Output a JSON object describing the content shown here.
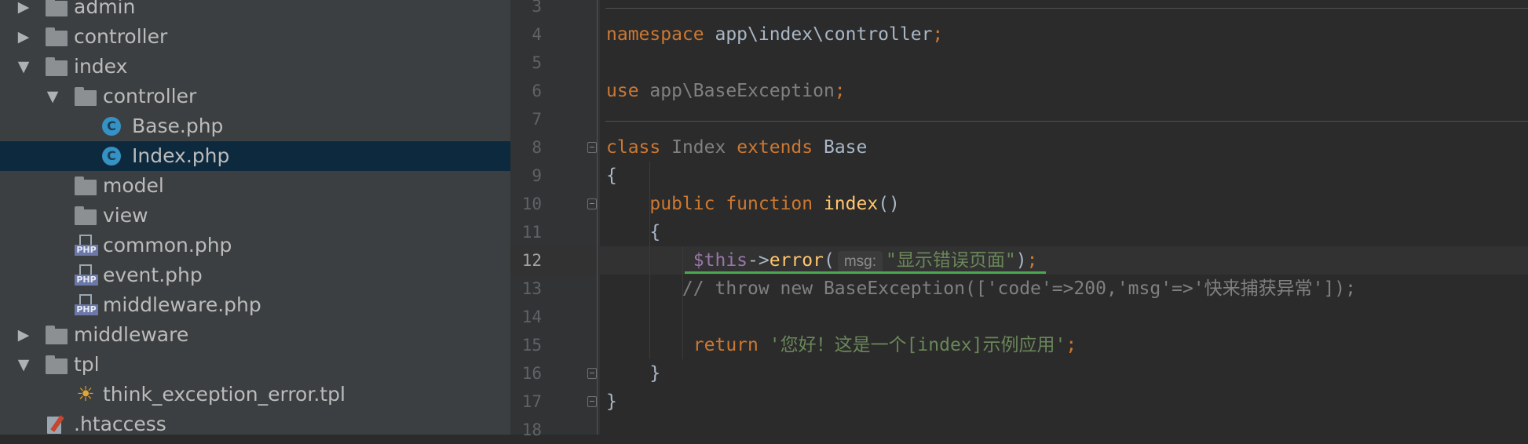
{
  "project_tree": [
    {
      "label": "admin",
      "type": "folder",
      "depth": 0,
      "arrow": "▶"
    },
    {
      "label": "controller",
      "type": "folder",
      "depth": 0,
      "arrow": "▶"
    },
    {
      "label": "index",
      "type": "folder",
      "depth": 0,
      "arrow": "▼"
    },
    {
      "label": "controller",
      "type": "folder",
      "depth": 1,
      "arrow": "▼"
    },
    {
      "label": "Base.php",
      "type": "php-class",
      "depth": 2,
      "arrow": ""
    },
    {
      "label": "Index.php",
      "type": "php-class",
      "depth": 2,
      "arrow": "",
      "selected": true
    },
    {
      "label": "model",
      "type": "folder",
      "depth": 1,
      "arrow": ""
    },
    {
      "label": "view",
      "type": "folder",
      "depth": 1,
      "arrow": ""
    },
    {
      "label": "common.php",
      "type": "php-file",
      "depth": 1,
      "arrow": ""
    },
    {
      "label": "event.php",
      "type": "php-file",
      "depth": 1,
      "arrow": ""
    },
    {
      "label": "middleware.php",
      "type": "php-file",
      "depth": 1,
      "arrow": ""
    },
    {
      "label": "middleware",
      "type": "folder",
      "depth": 0,
      "arrow": "▶"
    },
    {
      "label": "tpl",
      "type": "folder",
      "depth": 0,
      "arrow": "▼"
    },
    {
      "label": "think_exception_error.tpl",
      "type": "tpl-file",
      "depth": 1,
      "arrow": ""
    },
    {
      "label": ".htaccess",
      "type": "htaccess-file",
      "depth": 0,
      "arrow": ""
    }
  ],
  "icons": {
    "php_class_glyph": "C",
    "php_file_tag": "PHP",
    "tpl_glyph": "☀"
  },
  "editor": {
    "current_line": "12",
    "lines": [
      {
        "num": "3",
        "tokens": []
      },
      {
        "num": "4",
        "tokens": [
          {
            "t": "namespace",
            "c": "kw"
          },
          {
            "t": " app\\index\\controller",
            "c": "ns"
          },
          {
            "t": ";",
            "c": "kw"
          }
        ]
      },
      {
        "num": "5",
        "tokens": []
      },
      {
        "num": "6",
        "tokens": [
          {
            "t": "use",
            "c": "kw"
          },
          {
            "t": " app\\BaseException",
            "c": "dim"
          },
          {
            "t": ";",
            "c": "kw"
          }
        ]
      },
      {
        "num": "7",
        "tokens": []
      },
      {
        "num": "8",
        "tokens": [
          {
            "t": "class",
            "c": "kw"
          },
          {
            "t": " Index ",
            "c": "dim"
          },
          {
            "t": "extends",
            "c": "kw"
          },
          {
            "t": " Base",
            "c": "ns"
          }
        ]
      },
      {
        "num": "9",
        "tokens": [
          {
            "t": "{",
            "c": "ns"
          }
        ]
      },
      {
        "num": "10",
        "tokens": [
          {
            "t": "    public ",
            "c": "kw"
          },
          {
            "t": "function ",
            "c": "kw"
          },
          {
            "t": "index",
            "c": "fn"
          },
          {
            "t": "()",
            "c": "ns"
          }
        ]
      },
      {
        "num": "11",
        "tokens": [
          {
            "t": "    {",
            "c": "ns"
          }
        ]
      },
      {
        "num": "12",
        "tokens": [
          {
            "t": "        $this",
            "c": "var"
          },
          {
            "t": "->",
            "c": "ns"
          },
          {
            "t": "error",
            "c": "fn"
          },
          {
            "t": "(",
            "c": "ns"
          },
          {
            "t": "msg:",
            "c": "hint"
          },
          {
            "t": "\"显示错误页面\"",
            "c": "str"
          },
          {
            "t": ")",
            "c": "ns"
          },
          {
            "t": ";",
            "c": "kw"
          }
        ]
      },
      {
        "num": "13",
        "tokens": [
          {
            "t": "       // throw new BaseException(['code'=>200,'msg'=>'快来捕获异常']);",
            "c": "cmt"
          }
        ]
      },
      {
        "num": "14",
        "tokens": []
      },
      {
        "num": "15",
        "tokens": [
          {
            "t": "        return ",
            "c": "kw"
          },
          {
            "t": "'您好！这是一个[index]示例应用'",
            "c": "str"
          },
          {
            "t": ";",
            "c": "kw"
          }
        ]
      },
      {
        "num": "16",
        "tokens": [
          {
            "t": "    }",
            "c": "ns"
          }
        ]
      },
      {
        "num": "17",
        "tokens": [
          {
            "t": "}",
            "c": "ns"
          }
        ]
      },
      {
        "num": "18",
        "tokens": []
      }
    ]
  },
  "colors": {
    "tree_bg": "#3c3f41",
    "selection": "#0d293e",
    "editor_bg": "#2b2b2b",
    "keyword": "#cc7832",
    "string": "#6a8759",
    "function": "#ffc66d",
    "variable": "#9876aa"
  }
}
